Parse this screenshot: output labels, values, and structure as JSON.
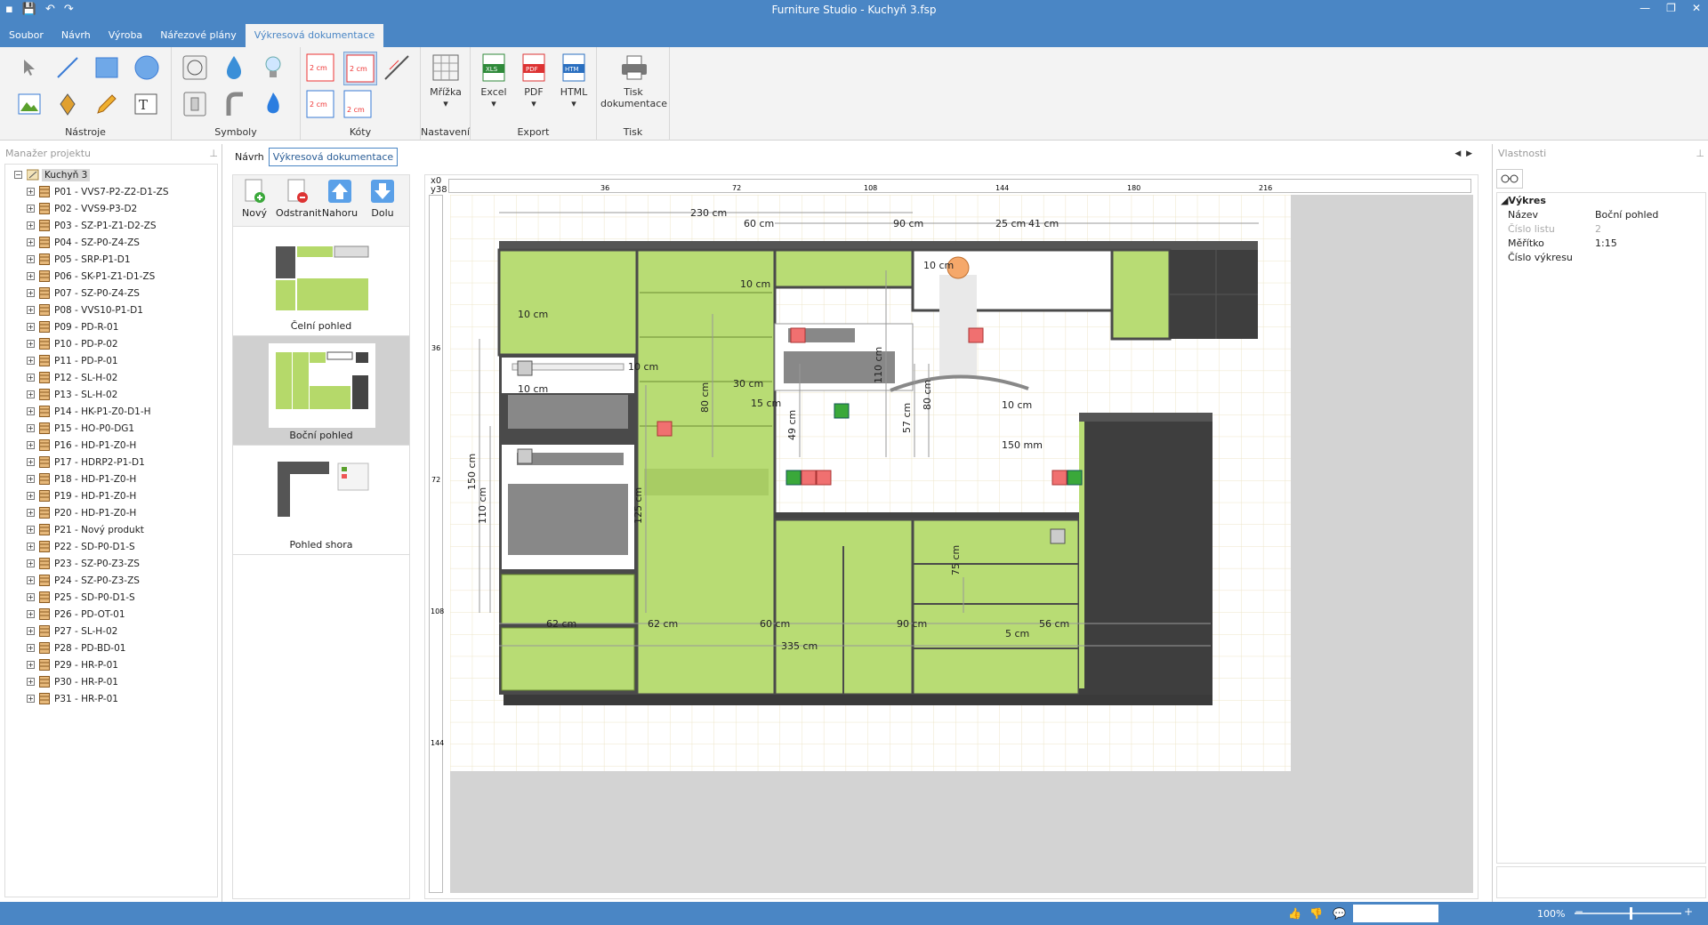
{
  "app": {
    "title": "Furniture Studio - Kuchyň 3.fsp"
  },
  "menu": {
    "tabs": [
      "Soubor",
      "Návrh",
      "Výroba",
      "Nářezové plány",
      "Výkresová dokumentace"
    ]
  },
  "ribbon": {
    "tools_label": "Nástroje",
    "symbols_label": "Symboly",
    "dims_label": "Kóty",
    "settings_label": "Nastavení",
    "grid_label": "Mřížka",
    "export_label": "Export",
    "excel_label": "Excel",
    "pdf_label": "PDF",
    "html_label": "HTML",
    "print_group_label": "Tisk",
    "print_label": "Tisk dokumentace",
    "dim_icon_text": "2 cm",
    "xls_text": "XLS",
    "pdf_text": "PDF",
    "htm_text": "HTM"
  },
  "left": {
    "header": "Manažer projektu",
    "root": "Kuchyň 3",
    "items": [
      "P01 - VVS7-P2-Z2-D1-ZS",
      "P02 - VVS9-P3-D2",
      "P03 - SZ-P1-Z1-D2-ZS",
      "P04 - SZ-P0-Z4-ZS",
      "P05 - SRP-P1-D1",
      "P06 - SK-P1-Z1-D1-ZS",
      "P07 - SZ-P0-Z4-ZS",
      "P08 - VVS10-P1-D1",
      "P09 - PD-R-01",
      "P10 - PD-P-02",
      "P11 - PD-P-01",
      "P12 - SL-H-02",
      "P13 - SL-H-02",
      "P14 - HK-P1-Z0-D1-H",
      "P15 - HO-P0-DG1",
      "P16 - HD-P1-Z0-H",
      "P17 - HDRP2-P1-D1",
      "P18 - HD-P1-Z0-H",
      "P19 - HD-P1-Z0-H",
      "P20 - HD-P1-Z0-H",
      "P21 - Nový produkt",
      "P22 - SD-P0-D1-S",
      "P23 - SZ-P0-Z3-ZS",
      "P24 - SZ-P0-Z3-ZS",
      "P25 - SD-P0-D1-S",
      "P26 - PD-OT-01",
      "P27 - SL-H-02",
      "P28 - PD-BD-01",
      "P29 - HR-P-01",
      "P30 - HR-P-01",
      "P31 - HR-P-01"
    ]
  },
  "center": {
    "tabs": [
      "Návrh",
      "Výkresová dokumentace"
    ],
    "toolbar": {
      "new": "Nový",
      "remove": "Odstranit",
      "up": "Nahoru",
      "down": "Dolu"
    },
    "views": [
      "Čelní pohled",
      "Boční pohled",
      "Pohled shora"
    ],
    "ruler": {
      "x_origin": "x0",
      "y_origin": "y38",
      "h_ticks": [
        "36",
        "72",
        "108",
        "144",
        "180",
        "216"
      ],
      "v_ticks": [
        "36",
        "72",
        "108",
        "144"
      ]
    },
    "dims": {
      "top_total": "230 cm",
      "top_60": "60 cm",
      "top_90": "90 cm",
      "top_25": "25 cm",
      "top_41": "41 cm",
      "hood_10": "10 cm",
      "oven_10a": "10 cm",
      "oven_10b": "10 cm",
      "socket_10": "10 cm",
      "mid_10": "10 cm",
      "h80a": "80 cm",
      "w30": "30 cm",
      "w15": "15 cm",
      "h49": "49 cm",
      "h110a": "110 cm",
      "h57": "57 cm",
      "h80b": "80 cm",
      "r10": "10 cm",
      "mm150": "150 mm",
      "h150": "150 cm",
      "h110b": "110 cm",
      "h125": "125 cm",
      "h75": "75 cm",
      "b62a": "62 cm",
      "b62b": "62 cm",
      "b60": "60 cm",
      "b90": "90 cm",
      "b56": "56 cm",
      "b5": "5 cm",
      "b335": "335 cm"
    }
  },
  "right": {
    "header": "Vlastnosti",
    "section": "Výkres",
    "props": [
      {
        "k": "Název",
        "v": "Boční pohled"
      },
      {
        "k": "Číslo listu",
        "v": "2"
      },
      {
        "k": "Měřítko",
        "v": "1:15"
      },
      {
        "k": "Číslo výkresu",
        "v": ""
      }
    ]
  },
  "status": {
    "zoom": "100%"
  }
}
